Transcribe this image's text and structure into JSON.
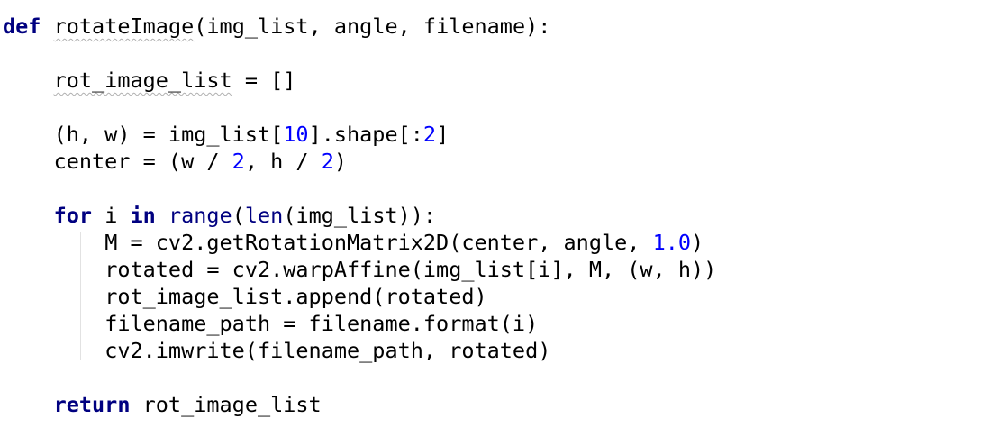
{
  "editor": {
    "lines": {
      "l1": {
        "kw_def": "def",
        "fn_name": "rotateImage",
        "params": "(img_list, angle, filename):"
      },
      "l2": {
        "var": "rot_image_list",
        "rest": " = []"
      },
      "l3": {
        "lhs": "(h, w) = img_list[",
        "index": "10",
        "mid": "].shape[:",
        "slice_end": "2",
        "close": "]"
      },
      "l4": {
        "lhs": "center = (w / ",
        "n1": "2",
        "mid": ", h / ",
        "n2": "2",
        "close": ")"
      },
      "l5": {
        "kw_for": "for",
        "var": " i ",
        "kw_in": "in",
        "sp": " ",
        "fn_range": "range",
        "paren": "(",
        "fn_len": "len",
        "rest": "(img_list)):"
      },
      "l6": {
        "text": "M = cv2.getRotationMatrix2D(center, angle, ",
        "num": "1.0",
        "close": ")"
      },
      "l7": {
        "text": "rotated = cv2.warpAffine(img_list[i], M, (w, h))"
      },
      "l8": {
        "text": "rot_image_list.append(rotated)"
      },
      "l9": {
        "text": "filename_path = filename.format(i)"
      },
      "l10": {
        "text": "cv2.imwrite(filename_path, rotated)"
      },
      "l11": {
        "kw_return": "return",
        "rest": " rot_image_list"
      }
    },
    "colors": {
      "keyword": "#000080",
      "number": "#0000ff",
      "text": "#000000",
      "background": "#ffffff"
    }
  }
}
